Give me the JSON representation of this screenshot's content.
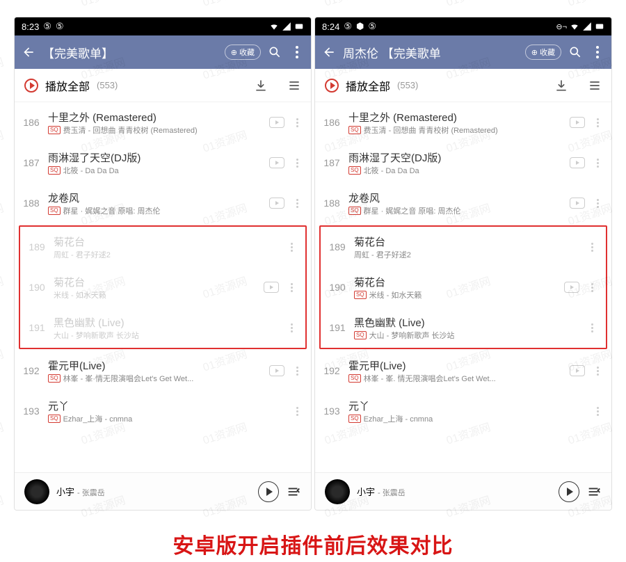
{
  "caption": "安卓版开启插件前后效果对比",
  "watermark": "01资源网",
  "sq_label": "SQ",
  "left": {
    "status": {
      "time": "8:23",
      "icons": [
        "netease-icon",
        "netease-icon"
      ],
      "right_icons": [
        "wifi-icon",
        "signal-icon",
        "battery-icon"
      ]
    },
    "header": {
      "title": "【完美歌单】",
      "fav": "收藏"
    },
    "play_all": {
      "label": "播放全部",
      "count": "(553)"
    },
    "top_songs": [
      {
        "num": "186",
        "title": "十里之外 (Remastered)",
        "sq": true,
        "sub": "费玉清 - 回想曲 青青校树 (Remastered)",
        "mv": true
      },
      {
        "num": "187",
        "title": "雨淋湿了天空(DJ版)",
        "sq": true,
        "sub": "北筱 - Da Da Da",
        "mv": true
      },
      {
        "num": "188",
        "title": "龙卷风",
        "sq": true,
        "sub": "群星 · 娓娓之音    原唱: 周杰伦",
        "mv": true
      }
    ],
    "boxed_songs": [
      {
        "num": "189",
        "title": "菊花台",
        "sq": false,
        "sub": "周虹 - 君子好逑2",
        "mv": false,
        "disabled": true
      },
      {
        "num": "190",
        "title": "菊花台",
        "sq": false,
        "sub": "米线 - 如水天籁",
        "mv": true,
        "disabled": true
      },
      {
        "num": "191",
        "title": "黑色幽默 (Live)",
        "sq": false,
        "sub": "大山 - 梦响新歌声 长沙站",
        "mv": false,
        "disabled": true
      }
    ],
    "bottom_songs": [
      {
        "num": "192",
        "title": "霍元甲(Live)",
        "sq": true,
        "sub": "林峯 - 峯·情无限演唱会Let's Get Wet...",
        "mv": true
      },
      {
        "num": "193",
        "title": "元丫",
        "sq": true,
        "sub": "Ezhar_上海 - cnmna",
        "mv": false
      }
    ],
    "now_playing": {
      "title": "小宇",
      "artist": "- 张震岳"
    }
  },
  "right": {
    "status": {
      "time": "8:24",
      "icons": [
        "netease-icon",
        "shield-icon",
        "netease-icon"
      ],
      "right_icons": [
        "vpn-icon",
        "wifi-icon",
        "signal-icon",
        "battery-icon"
      ]
    },
    "header": {
      "title": "周杰伦 【完美歌单",
      "fav": "收藏"
    },
    "play_all": {
      "label": "播放全部",
      "count": "(553)"
    },
    "top_songs": [
      {
        "num": "186",
        "title": "十里之外 (Remastered)",
        "sq": true,
        "sub": "费玉清 - 回想曲 青青校树 (Remastered)",
        "mv": true
      },
      {
        "num": "187",
        "title": "雨淋湿了天空(DJ版)",
        "sq": true,
        "sub": "北筱 - Da Da Da",
        "mv": true
      },
      {
        "num": "188",
        "title": "龙卷风",
        "sq": true,
        "sub": "群星 · 娓娓之音    原唱: 周杰伦",
        "mv": true
      }
    ],
    "boxed_songs": [
      {
        "num": "189",
        "title": "菊花台",
        "sq": false,
        "sub": "周虹 - 君子好逑2",
        "mv": false,
        "disabled": false
      },
      {
        "num": "190",
        "title": "菊花台",
        "sq": true,
        "sub": "米线 - 如水天籁",
        "mv": true,
        "disabled": false
      },
      {
        "num": "191",
        "title": "黑色幽默 (Live)",
        "sq": true,
        "sub": "大山 - 梦响新歌声 长沙站",
        "mv": false,
        "disabled": false
      }
    ],
    "bottom_songs": [
      {
        "num": "192",
        "title": "霍元甲(Live)",
        "sq": true,
        "sub": "林峯 - 峯. 情无限演唱会Let's Get Wet...",
        "mv": true
      },
      {
        "num": "193",
        "title": "元丫",
        "sq": true,
        "sub": "Ezhar_上海 - cnmna",
        "mv": false
      }
    ],
    "now_playing": {
      "title": "小宇",
      "artist": "- 张震岳"
    }
  }
}
